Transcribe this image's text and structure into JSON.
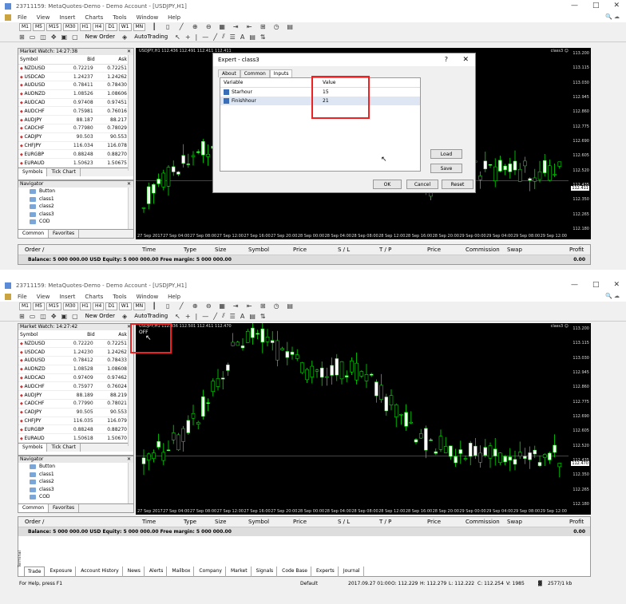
{
  "window": {
    "title": "23711159: MetaQuotes-Demo - Demo Account - [USDJPY,H1]",
    "controls": [
      "—",
      "□",
      "✕"
    ]
  },
  "menu": {
    "items": [
      "File",
      "View",
      "Insert",
      "Charts",
      "Tools",
      "Window",
      "Help"
    ]
  },
  "timeframes": [
    "M1",
    "M5",
    "M15",
    "M30",
    "H1",
    "H4",
    "D1",
    "W1",
    "MN"
  ],
  "toolbar": {
    "new_order": "New Order",
    "autotrading": "AutoTrading"
  },
  "top": {
    "market_watch": {
      "header": "Market Watch: 14:27:38",
      "columns": [
        "Symbol",
        "Bid",
        "Ask"
      ],
      "rows": [
        [
          "NZDUSD",
          "0.72219",
          "0.72251"
        ],
        [
          "USDCAD",
          "1.24237",
          "1.24262"
        ],
        [
          "AUDUSD",
          "0.78411",
          "0.78430"
        ],
        [
          "AUDNZD",
          "1.08526",
          "1.08606"
        ],
        [
          "AUDCAD",
          "0.97408",
          "0.97451"
        ],
        [
          "AUDCHF",
          "0.75981",
          "0.76016"
        ],
        [
          "AUDJPY",
          "88.187",
          "88.217"
        ],
        [
          "CADCHF",
          "0.77980",
          "0.78029"
        ],
        [
          "CADJPY",
          "90.503",
          "90.553"
        ],
        [
          "CHFJPY",
          "116.034",
          "116.078"
        ],
        [
          "EURGBP",
          "0.88248",
          "0.88270"
        ],
        [
          "EURAUD",
          "1.50623",
          "1.50675"
        ]
      ],
      "tabs": [
        "Symbols",
        "Tick Chart"
      ]
    },
    "navigator": {
      "header": "Navigator",
      "items": [
        "Button",
        "class1",
        "class2",
        "class3",
        "COD"
      ],
      "tabs": [
        "Common",
        "Favorites"
      ]
    },
    "chart": {
      "info": "USDJPY,H1  112.436 112.491 112.411 112.411",
      "label": "class3 ☺",
      "price_labels": [
        "113.200",
        "113.115",
        "113.030",
        "112.945",
        "112.860",
        "112.775",
        "112.690",
        "112.605",
        "112.520",
        "112.435",
        "112.350",
        "112.265",
        "112.180"
      ],
      "current_price": "112.411",
      "x_labels": [
        "27 Sep 2017",
        "27 Sep 04:00",
        "27 Sep 08:00",
        "27 Sep 12:00",
        "27 Sep 16:00",
        "27 Sep 20:00",
        "28 Sep 00:00",
        "28 Sep 04:00",
        "28 Sep 08:00",
        "28 Sep 12:00",
        "28 Sep 16:00",
        "28 Sep 20:00",
        "29 Sep 00:00",
        "29 Sep 04:00",
        "29 Sep 08:00",
        "29 Sep 12:00"
      ]
    },
    "dialog": {
      "title": "Expert - class3",
      "help": "?",
      "close": "✕",
      "tabs": [
        "About",
        "Common",
        "Inputs"
      ],
      "grid_headers": [
        "Variable",
        "Value"
      ],
      "inputs": [
        {
          "variable": "Starhour",
          "value": "15"
        },
        {
          "variable": "Finishhour",
          "value": "21"
        }
      ],
      "buttons": {
        "load": "Load",
        "save": "Save",
        "ok": "OK",
        "cancel": "Cancel",
        "reset": "Reset"
      }
    },
    "terminal": {
      "columns": [
        "Order",
        "/",
        "Time",
        "Type",
        "Size",
        "Symbol",
        "Price",
        "S / L",
        "T / P",
        "Price",
        "Commission",
        "Swap",
        "Profit"
      ],
      "balance": "Balance: 5 000 000.00 USD  Equity: 5 000 000.00  Free margin: 5 000 000.00",
      "profit": "0.00"
    }
  },
  "bottom": {
    "market_watch": {
      "header": "Market Watch: 14:27:42",
      "columns": [
        "Symbol",
        "Bid",
        "Ask"
      ],
      "rows": [
        [
          "NZDUSD",
          "0.72220",
          "0.72251"
        ],
        [
          "USDCAD",
          "1.24230",
          "1.24262"
        ],
        [
          "AUDUSD",
          "0.78412",
          "0.78433"
        ],
        [
          "AUDNZD",
          "1.08528",
          "1.08608"
        ],
        [
          "AUDCAD",
          "0.97409",
          "0.97462"
        ],
        [
          "AUDCHF",
          "0.75977",
          "0.76024"
        ],
        [
          "AUDJPY",
          "88.189",
          "88.219"
        ],
        [
          "CADCHF",
          "0.77990",
          "0.78021"
        ],
        [
          "CADJPY",
          "90.505",
          "90.553"
        ],
        [
          "CHFJPY",
          "116.035",
          "116.079"
        ],
        [
          "EURGBP",
          "0.88248",
          "0.88270"
        ],
        [
          "EURAUD",
          "1.50618",
          "1.50670"
        ]
      ],
      "tabs": [
        "Symbols",
        "Tick Chart"
      ]
    },
    "navigator": {
      "header": "Navigator",
      "items": [
        "Button",
        "class1",
        "class2",
        "class3",
        "COD"
      ],
      "tabs": [
        "Common",
        "Favorites"
      ]
    },
    "chart": {
      "info": "USDJPY,H1  112.436 112.501 112.411 112.470",
      "overlay": "OFF",
      "label": "class3 ☺",
      "price_labels": [
        "113.200",
        "113.115",
        "113.030",
        "112.945",
        "112.860",
        "112.775",
        "112.690",
        "112.605",
        "112.520",
        "112.435",
        "112.350",
        "112.265",
        "112.180"
      ],
      "current_price": "112.470",
      "x_labels": [
        "27 Sep 2017",
        "27 Sep 04:00",
        "27 Sep 08:00",
        "27 Sep 12:00",
        "27 Sep 16:00",
        "27 Sep 20:00",
        "28 Sep 00:00",
        "28 Sep 04:00",
        "28 Sep 08:00",
        "28 Sep 12:00",
        "28 Sep 16:00",
        "28 Sep 20:00",
        "29 Sep 00:00",
        "29 Sep 04:00",
        "29 Sep 08:00",
        "29 Sep 12:00"
      ]
    },
    "terminal": {
      "columns": [
        "Order",
        "/",
        "Time",
        "Type",
        "Size",
        "Symbol",
        "Price",
        "S / L",
        "T / P",
        "Price",
        "Commission",
        "Swap",
        "Profit"
      ],
      "balance": "Balance: 5 000 000.00 USD  Equity: 5 000 000.00  Free margin: 5 000 000.00",
      "profit": "0.00",
      "side_label": "Terminal",
      "tabs": [
        "Trade",
        "Exposure",
        "Account History",
        "News",
        "Alerts",
        "Mailbox",
        "Company",
        "Market",
        "Signals",
        "Code Base",
        "Experts",
        "Journal"
      ]
    },
    "status": {
      "help": "For Help, press F1",
      "profile": "Default",
      "datetime": "2017.09.27 01:00",
      "open": "O: 112.229",
      "high": "H: 112.279",
      "low": "L: 112.222",
      "close": "C: 112.254",
      "volume": "V: 1985",
      "traffic": "2577/1 kb"
    }
  },
  "colors": {
    "bull": "#ffffff",
    "bear": "#000000",
    "wick": "#00ff00",
    "highlight": "#e22222"
  },
  "icons": [
    "new-chart-icon",
    "profiles-icon",
    "zoom-in-icon",
    "zoom-out-icon",
    "crosshair-icon",
    "cursor-icon",
    "line-icon",
    "fibonacci-icon",
    "text-icon"
  ]
}
